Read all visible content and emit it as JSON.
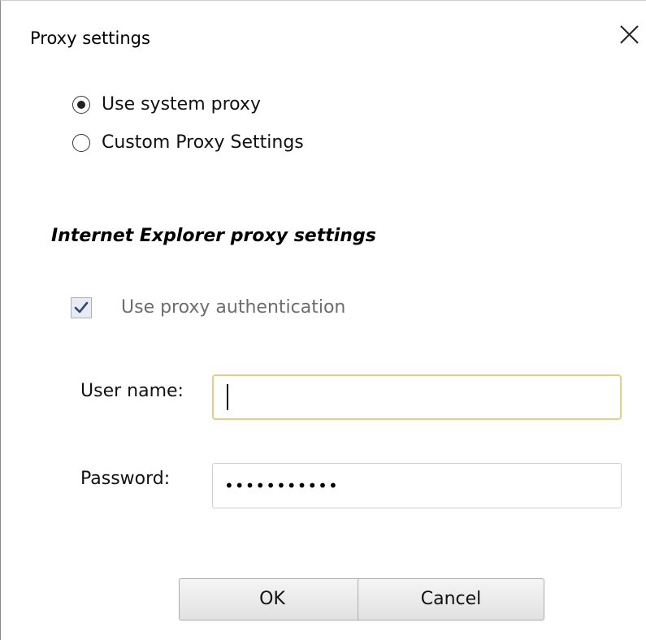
{
  "dialog": {
    "title": "Proxy settings",
    "close_icon": "close-icon"
  },
  "proxy_mode": {
    "options": [
      {
        "label": "Use system proxy",
        "selected": true
      },
      {
        "label": "Custom Proxy Settings",
        "selected": false
      }
    ]
  },
  "section": {
    "title": "Internet Explorer proxy settings"
  },
  "auth": {
    "label": "Use proxy authentication",
    "checked": true,
    "disabled": true
  },
  "fields": {
    "username_label": "User name:",
    "username_value": "",
    "password_label": "Password:",
    "password_value": "•••••••••••"
  },
  "buttons": {
    "ok_label": "OK",
    "cancel_label": "Cancel"
  },
  "colors": {
    "focus_border": "#e4cf8a",
    "disabled_text": "#6d6d6d",
    "checkbox_fill": "#e8ecf2",
    "checkmark": "#2b4a7a"
  }
}
